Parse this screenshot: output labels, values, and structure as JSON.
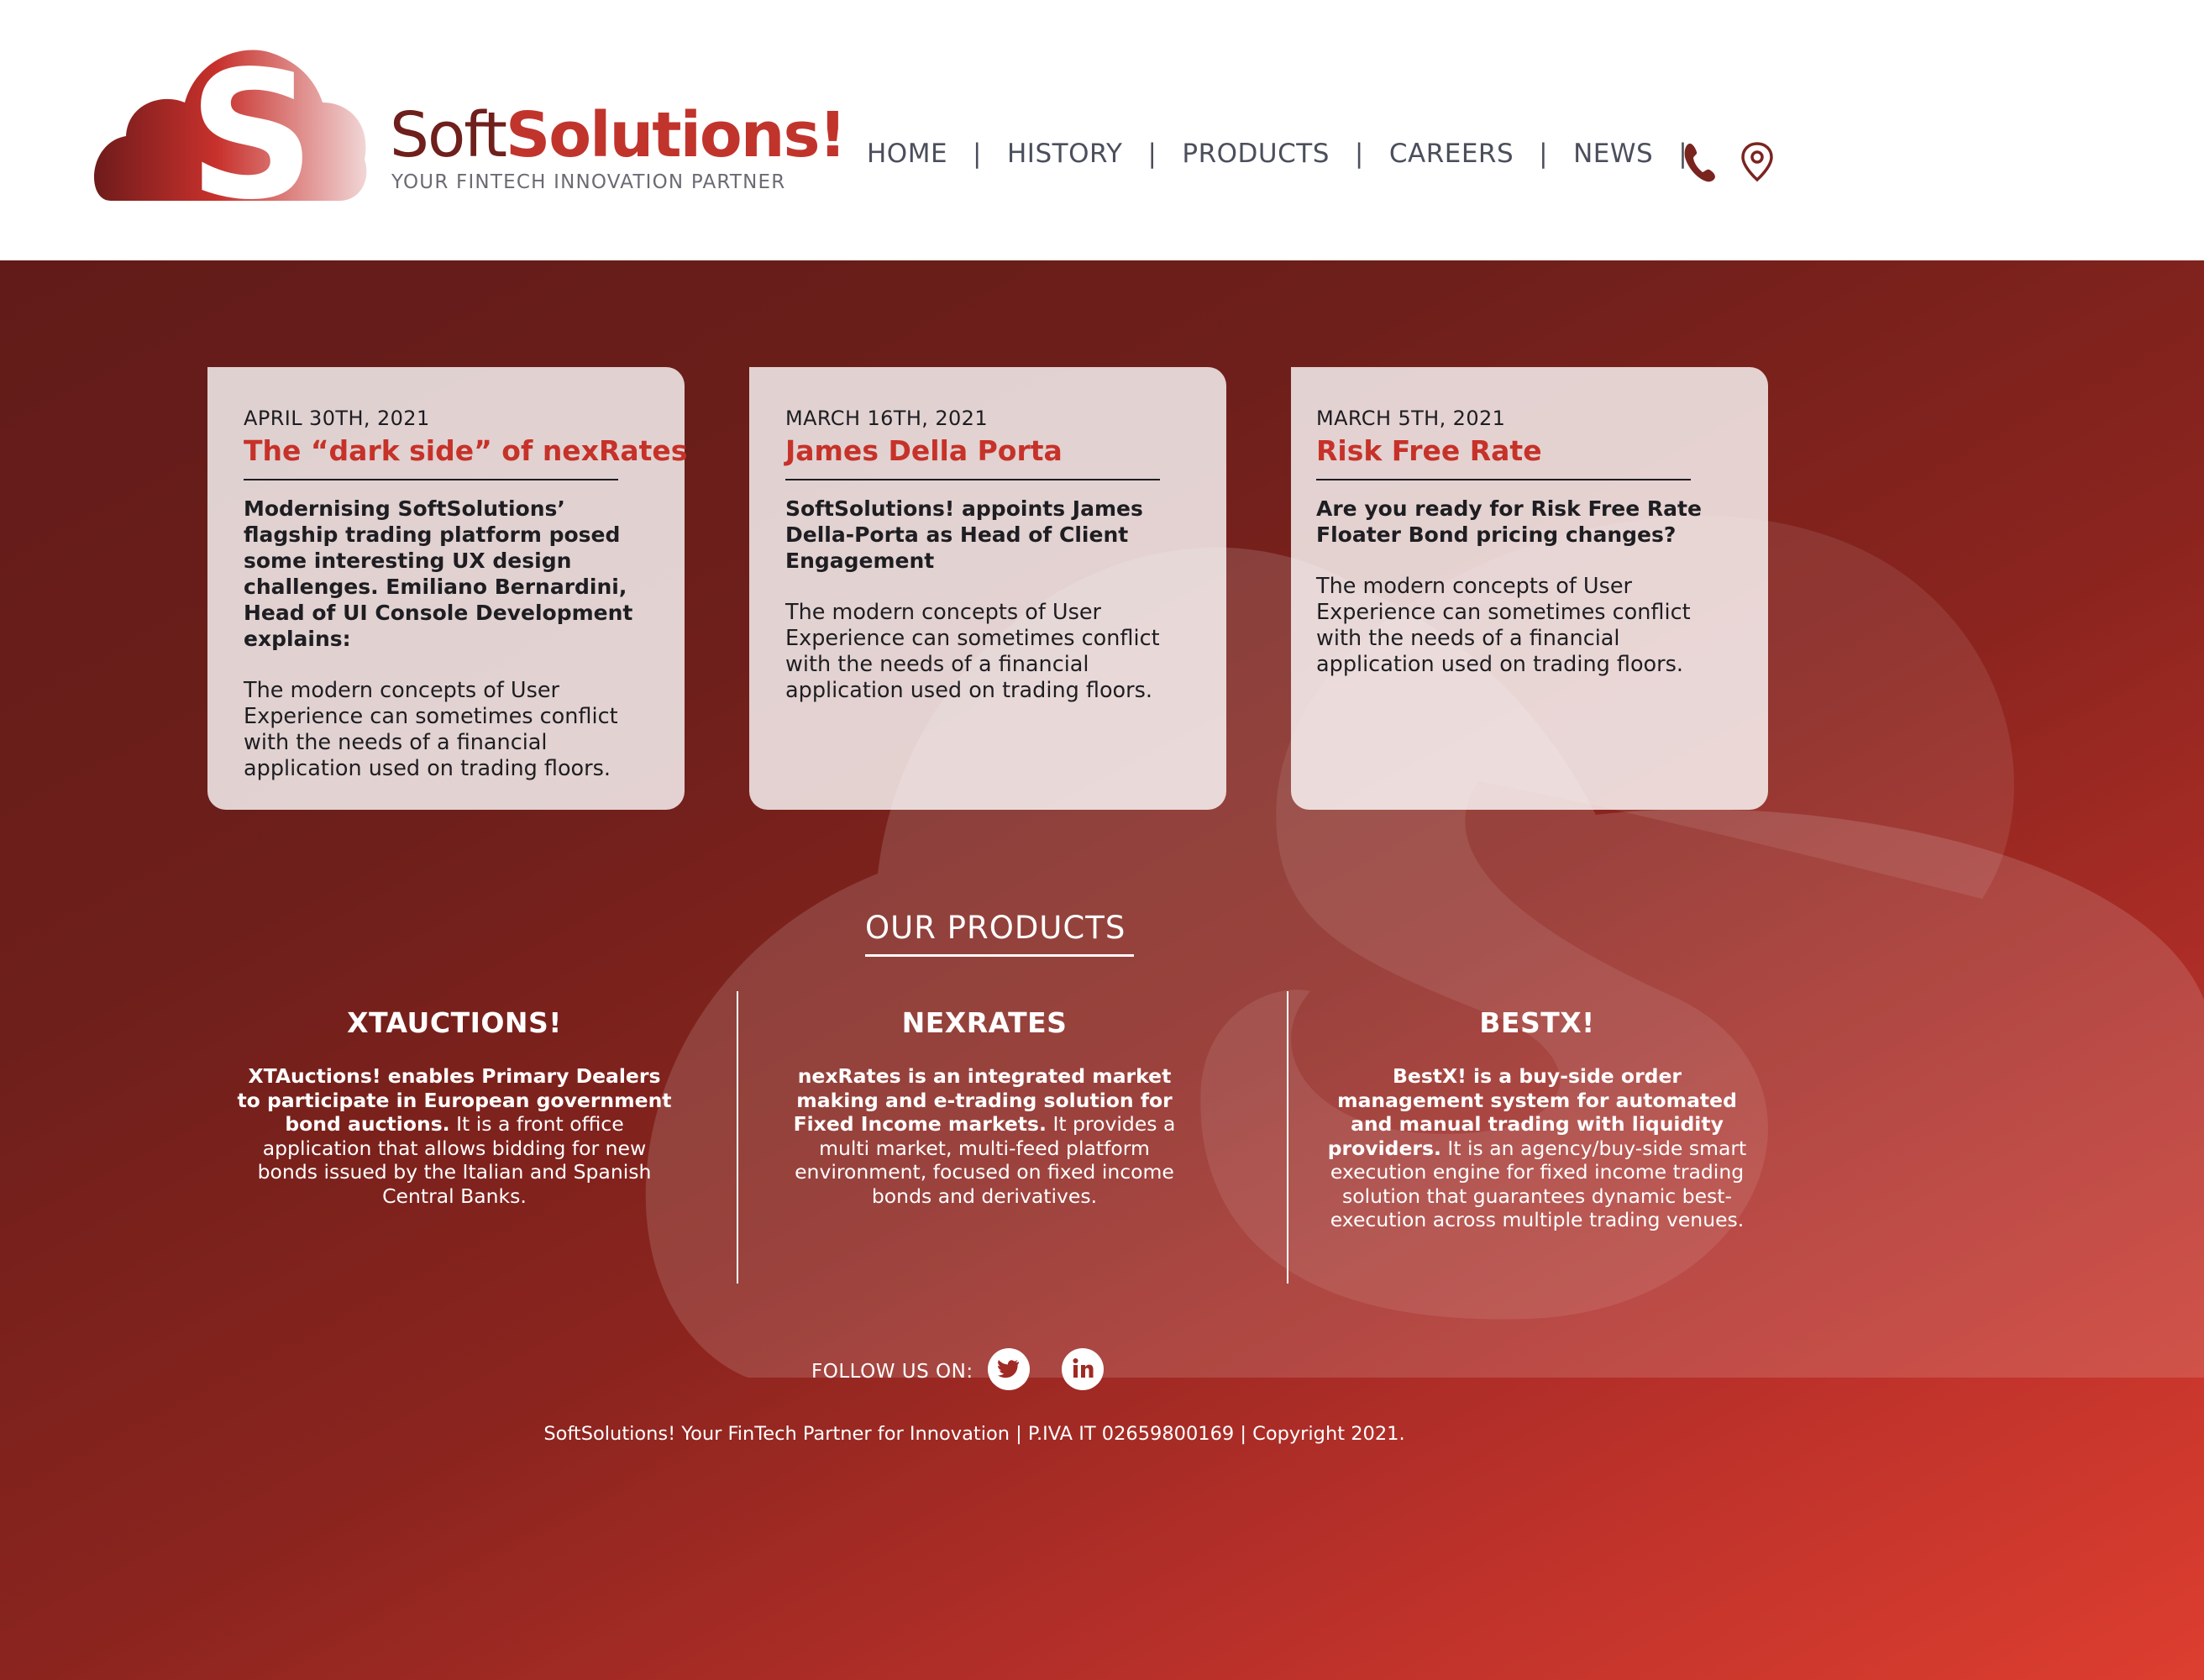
{
  "header": {
    "brand_soft": "Soft",
    "brand_solutions": "Solutions!",
    "tagline": "YOUR FINTECH INNOVATION PARTNER",
    "nav": [
      "HOME",
      "HISTORY",
      "PRODUCTS",
      "CAREERS",
      "NEWS"
    ],
    "separator": "|",
    "icons": [
      "phone-icon",
      "location-pin-icon"
    ]
  },
  "news": [
    {
      "date": "APRIL 30TH, 2021",
      "title": "The “dark side” of nexRates",
      "lead": "Modernising SoftSolutions’ flagship trading platform posed some interesting UX design challenges. Emiliano Bernardini, Head of UI Console Development explains:",
      "body": "The modern concepts of User Experience can sometimes conflict with the needs of a financial application used on trading floors."
    },
    {
      "date": "MARCH 16TH, 2021",
      "title": "James Della Porta",
      "lead": "SoftSolutions! appoints James Della-Porta as Head of Client Engagement",
      "body": "The modern concepts of User Experience can sometimes conflict with the needs of a financial application used on trading floors."
    },
    {
      "date": "MARCH 5TH, 2021",
      "title": "Risk Free Rate",
      "lead": "Are you ready for Risk Free Rate Floater Bond pricing changes?",
      "body": "The modern concepts of User Experience can sometimes conflict with the needs of a financial application used on trading floors."
    }
  ],
  "products": {
    "heading": "OUR PRODUCTS",
    "items": [
      {
        "name": "XTAUCTIONS!",
        "bold": "XTAuctions! enables Primary Dealers to participate in European government bond auctions.",
        "text": "It is a front office application that allows bidding for new bonds issued by the Italian and Spanish Central Banks."
      },
      {
        "name": "NEXRATES",
        "bold": "nexRates is an integrated market making and e-trading solution for Fixed Income markets.",
        "text": "It provides a multi market, multi-feed platform environment, focused on fixed income bonds and derivatives."
      },
      {
        "name": "BESTX!",
        "bold": "BestX! is a buy-side order management system for automated and manual trading with liquidity providers.",
        "text": "It is an agency/buy-side smart execution engine for fixed income trading solution that guarantees dynamic best-execution across multiple trading venues."
      }
    ]
  },
  "follow": {
    "label": "FOLLOW US ON:",
    "icons": [
      "twitter-icon",
      "linkedin-icon"
    ]
  },
  "footer": {
    "text": "SoftSolutions! Your FinTech Partner for Innovation | P.IVA IT 02659800169 | Copyright 2021."
  },
  "colors": {
    "brand_dark": "#6f1f1c",
    "brand_red": "#c1342c",
    "title_red": "#c63229",
    "nav_text": "#4b4f5c",
    "bg_start": "#621b19",
    "bg_end": "#dd3e2f"
  }
}
